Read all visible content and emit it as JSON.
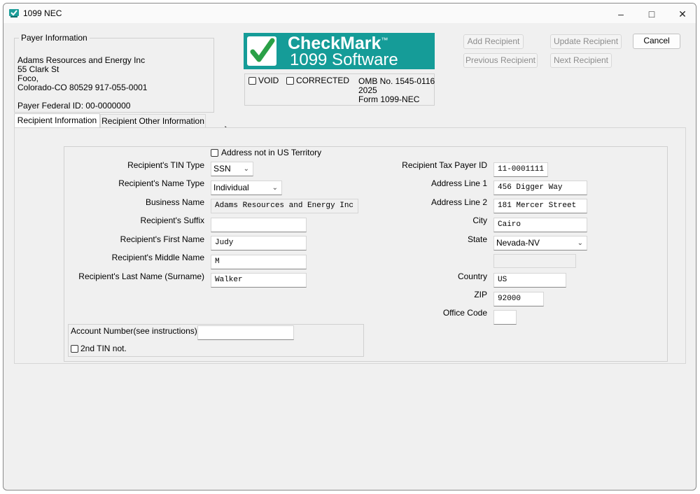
{
  "window": {
    "title": "1099 NEC"
  },
  "payer": {
    "legend": "Payer Information",
    "name": "Adams Resources and Energy Inc",
    "street": "55 Clark St",
    "city_line": "Foco,",
    "state_line": "Colorado-CO  80529  917-055-0001",
    "federal_id": "Payer Federal ID: 00-0000000"
  },
  "logo": {
    "line1": "CheckMark",
    "tm": "™",
    "line2": "1099 Software"
  },
  "form_info": {
    "void_label": "VOID",
    "corrected_label": "CORRECTED",
    "omb": "OMB No. 1545-0116",
    "year": "2025",
    "form": "Form 1099-NEC"
  },
  "buttons": {
    "add": "Add Recipient",
    "update": "Update Recipient",
    "cancel": "Cancel",
    "previous": "Previous Recipient",
    "next": "Next Recipient"
  },
  "tabs": {
    "info": "Recipient Information",
    "other": "Recipient Other Information"
  },
  "recipient": {
    "not_us_label": "Address not in US Territory",
    "tin_type_label": "Recipient's TIN Type",
    "tin_type": "SSN",
    "name_type_label": "Recipient's Name Type",
    "name_type": "Individual",
    "business_name_label": "Business Name",
    "business_name": "Adams Resources and Energy Inc",
    "suffix_label": "Recipient's Suffix",
    "suffix": "",
    "first_name_label": "Recipient's First Name",
    "first_name": "Judy",
    "middle_name_label": "Recipient's Middle Name",
    "middle_name": "M",
    "last_name_label": "Recipient's Last Name (Surname)",
    "last_name": "Walker",
    "tax_id_label": "Recipient Tax Payer ID",
    "tax_id": "11-0001111",
    "address1_label": "Address Line 1",
    "address1": "456 Digger Way",
    "address2_label": "Address Line 2",
    "address2": "181 Mercer Street",
    "city_label": "City",
    "city": "Cairo",
    "state_label": "State",
    "state": "Nevada-NV",
    "country_label": "Country",
    "country": "US",
    "zip_label": "ZIP",
    "zip": "92000",
    "office_code_label": "Office Code",
    "office_code": "",
    "account_label": "Account Number(see instructions)",
    "account": "",
    "second_tin_label": "2nd TIN not."
  }
}
